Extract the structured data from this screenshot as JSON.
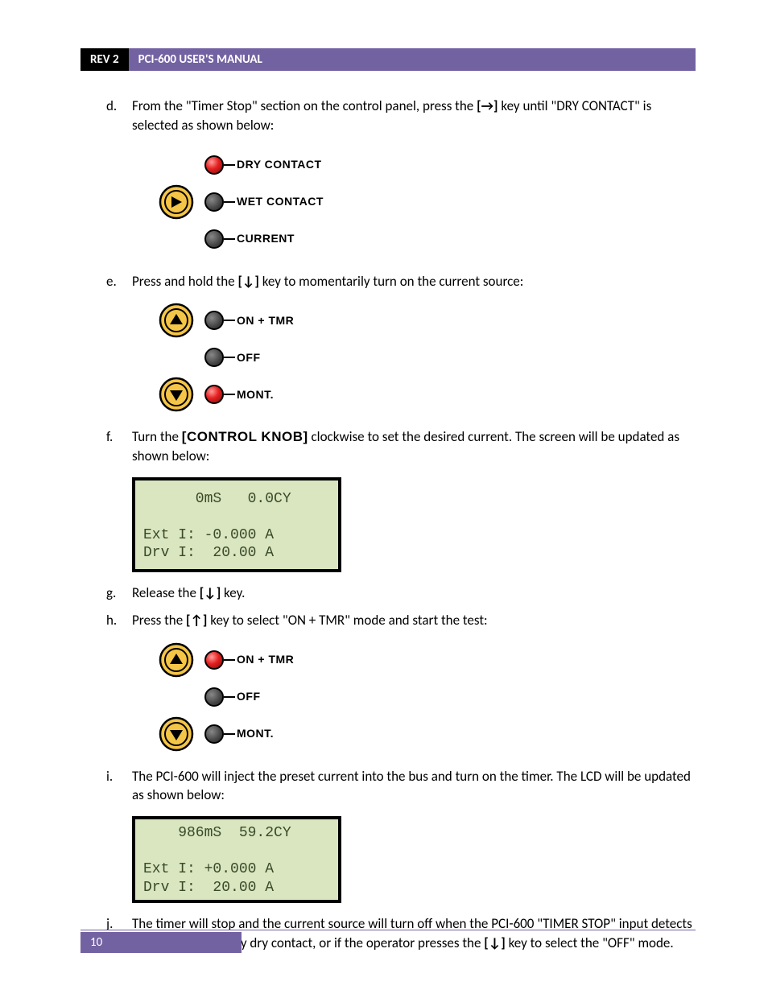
{
  "header": {
    "rev": "REV 2",
    "title": "PCI-600 USER'S MANUAL"
  },
  "items": {
    "d": {
      "marker": "d.",
      "before": "From the \"Timer Stop\" section on the control panel, press the ",
      "key": "[→]",
      "after": " key until \"DRY CONTACT\" is selected as shown below:"
    },
    "e": {
      "marker": "e.",
      "before": "Press and hold the ",
      "key": "[↓]",
      "after": " key to momentarily turn on the current source:"
    },
    "f": {
      "marker": "f.",
      "before": "Turn the ",
      "knob": "[CONTROL KNOB]",
      "after": " clockwise to set the desired current. The screen will be updated as shown below:"
    },
    "g": {
      "marker": "g.",
      "before": "Release the ",
      "key": "[↓]",
      "after": " key."
    },
    "h": {
      "marker": "h.",
      "before": "Press the ",
      "key": "[↑]",
      "after": " key to select \"ON + TMR\" mode and start the test:"
    },
    "i": {
      "marker": "i.",
      "text": "The PCI-600 will inject the preset current into the bus and turn on the timer. The LCD will be updated as shown below:"
    },
    "j": {
      "marker": "j.",
      "before": "The timer will stop and the current source will turn off when the PCI-600 \"TIMER STOP\" input detects a change in the relay dry contact, or if the operator presses the ",
      "key": "[↓]",
      "after": " key to select the \"OFF\" mode."
    }
  },
  "diagram_d": {
    "rows": [
      {
        "btn": "right",
        "led": "red",
        "label": "DRY CONTACT"
      },
      {
        "btn": "",
        "led": "off",
        "label": "WET CONTACT"
      },
      {
        "btn": "",
        "led": "off",
        "label": "CURRENT"
      }
    ]
  },
  "diagram_e": {
    "rows": [
      {
        "btn": "up",
        "led": "off",
        "label": "ON + TMR"
      },
      {
        "btn": "",
        "led": "off",
        "label": "OFF"
      },
      {
        "btn": "down",
        "led": "red",
        "label": "MONT."
      }
    ]
  },
  "diagram_h": {
    "rows": [
      {
        "btn": "up",
        "led": "red",
        "label": "ON + TMR"
      },
      {
        "btn": "",
        "led": "off",
        "label": "OFF"
      },
      {
        "btn": "down",
        "led": "off",
        "label": "MONT."
      }
    ]
  },
  "lcd1": {
    "line1": "      0mS   0.0CY",
    "line2": "",
    "line3": "Ext I: -0.000 A",
    "line4": "Drv I:  20.00 A"
  },
  "lcd2": {
    "line1": "    986mS  59.2CY",
    "line2": "",
    "line3": "Ext I: +0.000 A",
    "line4": "Drv I:  20.00 A"
  },
  "footer": {
    "page": "10"
  }
}
